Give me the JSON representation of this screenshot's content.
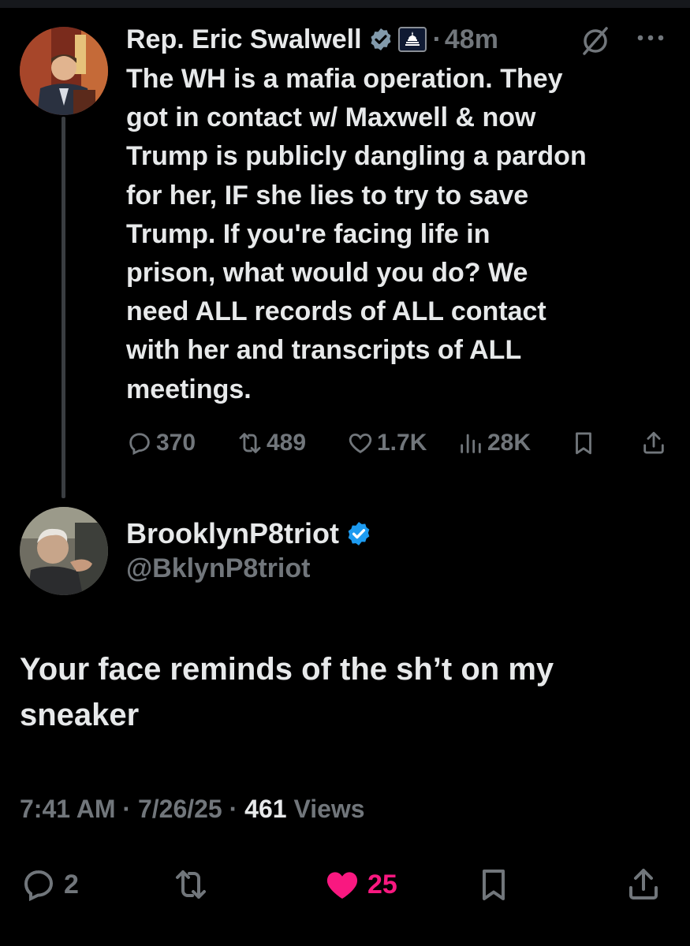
{
  "parent": {
    "author_name": "Rep. Eric Swalwell",
    "separator": "·",
    "time": "48m",
    "text": "The WH is a mafia operation.  They\ngot in contact w/  Maxwell & now\nTrump is publicly dangling a pardon\nfor her, IF she lies to try to save\nTrump.  If you're facing life in\nprison, what would you do?  We\nneed ALL records of ALL contact\nwith her and transcripts of ALL\nmeetings.",
    "replies": "370",
    "reposts": "489",
    "likes": "1.7K",
    "views": "28K",
    "icons": [
      "verified-gray-badge",
      "capitol-icon",
      "grok-icon",
      "more-icon",
      "reply-icon",
      "repost-icon",
      "like-icon",
      "views-icon",
      "bookmark-icon",
      "share-icon"
    ]
  },
  "reply": {
    "author_name": "BrooklynP8triot",
    "handle": "@BklynP8triot",
    "text": "Your face reminds of the sh’t on my\nsneaker",
    "time": "7:41 AM",
    "date": "7/26/25",
    "dot": "·",
    "views_count": "461",
    "views_label": "Views",
    "replies": "2",
    "likes": "25",
    "liked": true,
    "icons": [
      "verified-blue-badge",
      "reply-icon",
      "repost-icon",
      "like-filled-icon",
      "bookmark-icon",
      "share-icon"
    ]
  },
  "colors": {
    "background": "#000000",
    "text": "#e7e9ea",
    "muted": "#71767b",
    "verified_blue": "#1d9bf0",
    "verified_gray": "#829aab",
    "like_pink": "#f91880"
  }
}
